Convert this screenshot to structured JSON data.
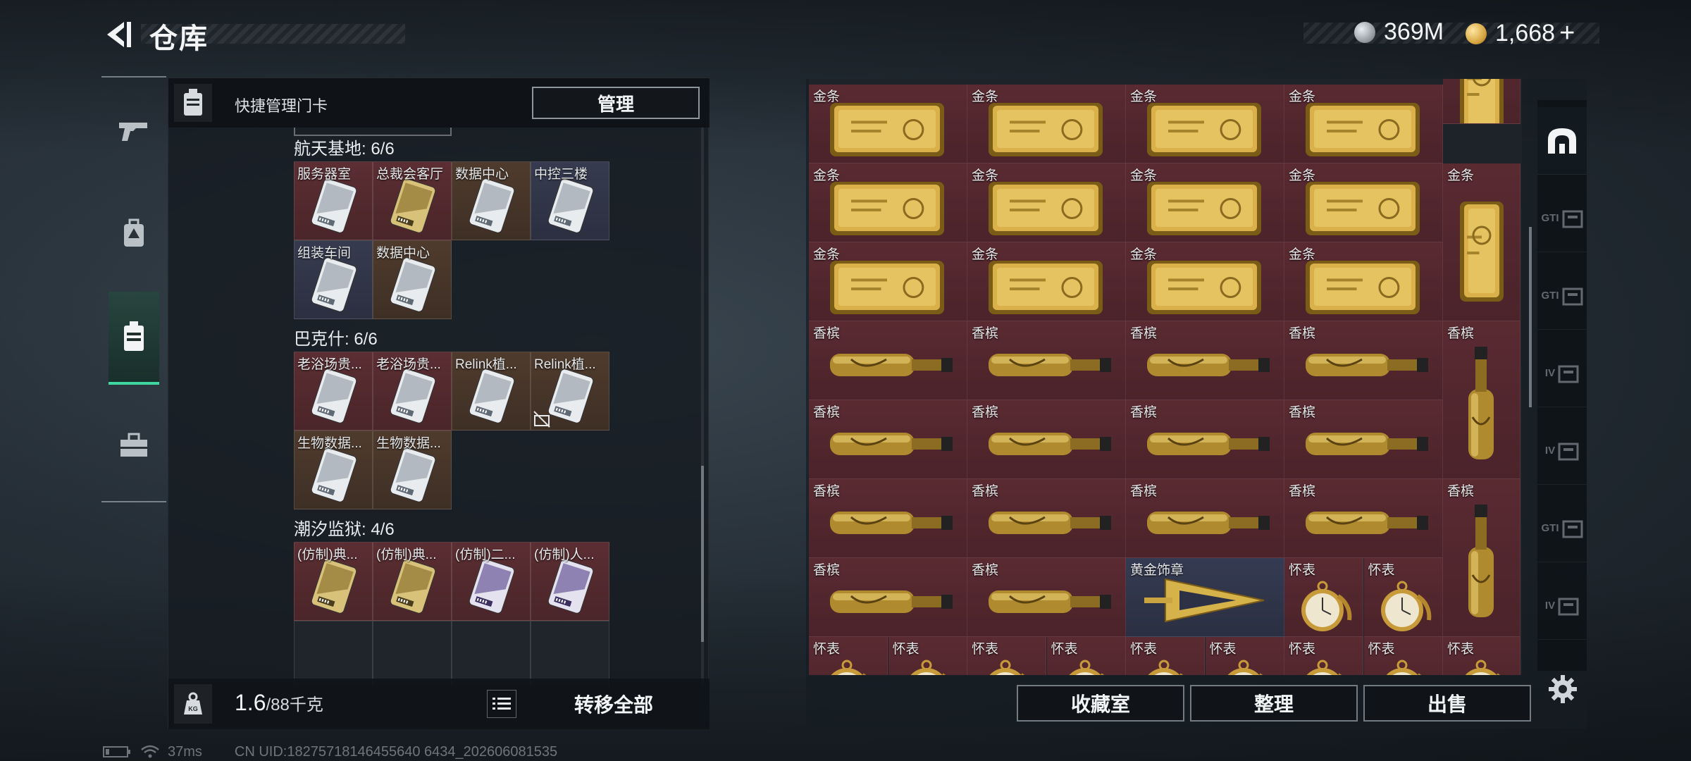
{
  "header": {
    "title": "仓库",
    "currency_silver": "369M",
    "currency_gold": "1,668",
    "gold_plus": "+"
  },
  "left_nav": {
    "items": [
      {
        "icon": "gun-icon",
        "active": false
      },
      {
        "icon": "backpack-icon",
        "active": false
      },
      {
        "icon": "keycard-case-icon",
        "active": true
      },
      {
        "icon": "briefcase-icon",
        "active": false
      }
    ]
  },
  "left_panel": {
    "header_label": "快捷管理门卡",
    "manage_button": "管理",
    "groups": [
      {
        "title": "航天基地: 6/6",
        "cards": [
          {
            "name": "服务器室",
            "color": "red",
            "style": "silver"
          },
          {
            "name": "总裁会客厅",
            "color": "red",
            "style": "gold"
          },
          {
            "name": "数据中心",
            "color": "brown",
            "style": "silver"
          },
          {
            "name": "中控三楼",
            "color": "blue",
            "style": "silver"
          },
          {
            "name": "组装车间",
            "color": "blue",
            "style": "silver"
          },
          {
            "name": "数据中心",
            "color": "brown",
            "style": "silver"
          }
        ]
      },
      {
        "title": "巴克什: 6/6",
        "cards": [
          {
            "name": "老浴场贵...",
            "color": "red",
            "style": "silver"
          },
          {
            "name": "老浴场贵...",
            "color": "red",
            "style": "silver"
          },
          {
            "name": "Relink植...",
            "color": "brown",
            "style": "silver"
          },
          {
            "name": "Relink植...",
            "color": "brown",
            "style": "silver",
            "locked": true
          },
          {
            "name": "生物数据...",
            "color": "brown",
            "style": "silver"
          },
          {
            "name": "生物数据...",
            "color": "brown",
            "style": "silver"
          }
        ]
      },
      {
        "title": "潮汐监狱: 4/6",
        "cards": [
          {
            "name": "(仿制)典...",
            "color": "red",
            "style": "gold"
          },
          {
            "name": "(仿制)典...",
            "color": "red",
            "style": "gold"
          },
          {
            "name": "(仿制)二...",
            "color": "red",
            "style": "purple"
          },
          {
            "name": "(仿制)人...",
            "color": "red",
            "style": "purple"
          }
        ]
      }
    ],
    "weight_current": "1.6",
    "weight_max": "/88千克",
    "transfer_button": "转移全部"
  },
  "inventory": {
    "items": [
      {
        "name": "金条",
        "type": "goldbar"
      },
      {
        "name": "金条",
        "type": "goldbar"
      },
      {
        "name": "金条",
        "type": "goldbar"
      },
      {
        "name": "金条",
        "type": "goldbar"
      },
      {
        "name": "金条",
        "type": "goldbar"
      },
      {
        "name": "金条",
        "type": "goldbar"
      },
      {
        "name": "金条",
        "type": "goldbar"
      },
      {
        "name": "金条",
        "type": "goldbar"
      },
      {
        "name": "金条",
        "type": "goldbar"
      },
      {
        "name": "金条",
        "type": "goldbar"
      },
      {
        "name": "金条",
        "type": "goldbar"
      },
      {
        "name": "金条",
        "type": "goldbar"
      },
      {
        "name": "金条",
        "type": "goldbar-vertical"
      },
      {
        "name": "香槟",
        "type": "champagne"
      },
      {
        "name": "香槟",
        "type": "champagne"
      },
      {
        "name": "香槟",
        "type": "champagne"
      },
      {
        "name": "香槟",
        "type": "champagne"
      },
      {
        "name": "香槟",
        "type": "champagne-vertical"
      },
      {
        "name": "香槟",
        "type": "champagne"
      },
      {
        "name": "香槟",
        "type": "champagne"
      },
      {
        "name": "香槟",
        "type": "champagne"
      },
      {
        "name": "香槟",
        "type": "champagne"
      },
      {
        "name": "香槟",
        "type": "champagne"
      },
      {
        "name": "香槟",
        "type": "champagne"
      },
      {
        "name": "香槟",
        "type": "champagne"
      },
      {
        "name": "香槟",
        "type": "champagne"
      },
      {
        "name": "香槟",
        "type": "champagne-vertical"
      },
      {
        "name": "香槟",
        "type": "champagne"
      },
      {
        "name": "香槟",
        "type": "champagne"
      },
      {
        "name": "黄金饰章",
        "type": "emblem"
      },
      {
        "name": "怀表",
        "type": "watch"
      },
      {
        "name": "怀表",
        "type": "watch"
      },
      {
        "name": "怀表",
        "type": "watch"
      },
      {
        "name": "怀表",
        "type": "watch"
      },
      {
        "name": "怀表",
        "type": "watch"
      },
      {
        "name": "怀表",
        "type": "watch"
      },
      {
        "name": "怀表",
        "type": "watch"
      },
      {
        "name": "怀表",
        "type": "watch"
      },
      {
        "name": "怀表",
        "type": "watch"
      },
      {
        "name": "怀表",
        "type": "watch"
      },
      {
        "name": "怀表",
        "type": "watch"
      },
      {
        "name": "怀表",
        "type": "watch"
      }
    ]
  },
  "side_tabs": [
    {
      "label": "",
      "icon": "home-storage-icon",
      "active": true
    },
    {
      "label": "GTI",
      "icon": "gti-warning-icon"
    },
    {
      "label": "GTI",
      "icon": "gti-truck-icon"
    },
    {
      "label": "IV",
      "icon": "iv-storage-icon"
    },
    {
      "label": "IV",
      "icon": "iv-storage-icon"
    },
    {
      "label": "GTI",
      "icon": "gti-storage-icon"
    },
    {
      "label": "IV",
      "icon": "iv-crate-icon"
    }
  ],
  "actions": {
    "collection": "收藏室",
    "sort": "整理",
    "sell": "出售"
  },
  "status_bar": {
    "ping": "37ms",
    "uid": "CN UID:18275718146455640 6434_202606081535"
  },
  "colors": {
    "accent_green": "#3fd7a0",
    "slot_red": "#5a2a31",
    "slot_blue": "#353b52",
    "slot_brown": "#4f3b2d"
  }
}
